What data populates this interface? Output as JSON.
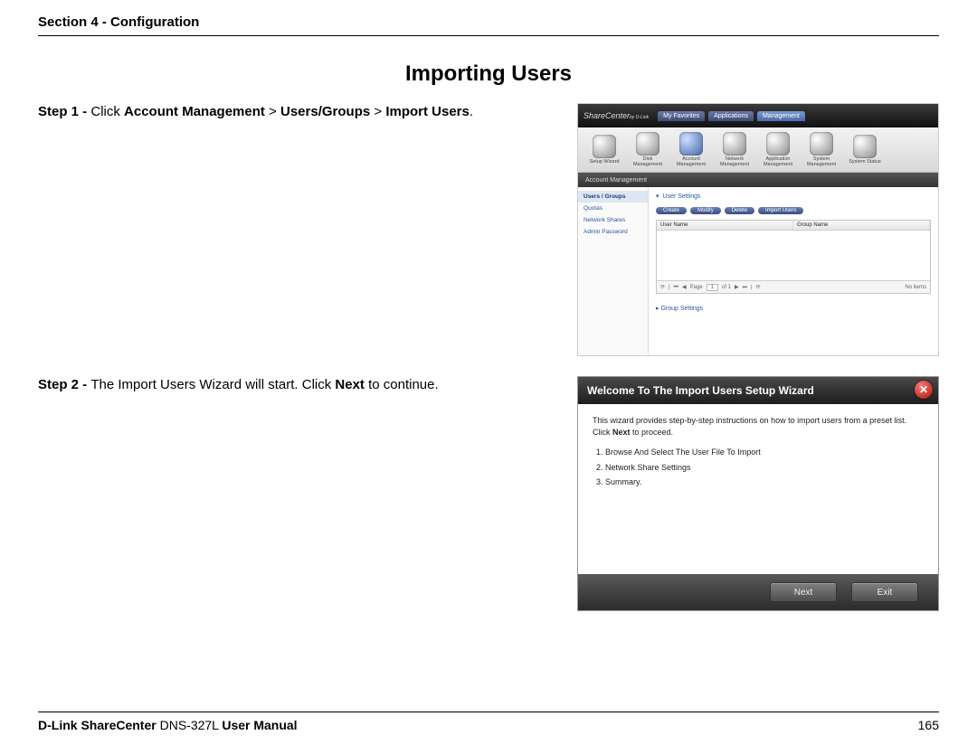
{
  "header": {
    "section": "Section 4 - Configuration"
  },
  "title": "Importing Users",
  "step1": {
    "prefix": "Step 1 - ",
    "before": "Click ",
    "bold1": "Account Management",
    "sep1": " > ",
    "bold2": "Users/Groups",
    "sep2": " > ",
    "bold3": "Import Users",
    "after": "."
  },
  "sharecenter": {
    "logo": "ShareCenter",
    "sublogo": "by D-Link",
    "tabs": [
      "My Favorites",
      "Applications",
      "Management"
    ],
    "tools": [
      "Setup Wizard",
      "Disk Management",
      "Account Management",
      "Network Management",
      "Application Management",
      "System Management",
      "System Status"
    ],
    "breadcrumb": "Account Management",
    "sidebar": [
      "Users / Groups",
      "Quotas",
      "Network Shares",
      "Admin Password"
    ],
    "user_settings_h": "User Settings",
    "buttons": [
      "Create",
      "Modify",
      "Delete",
      "Import Users"
    ],
    "cols": [
      "User Name",
      "Group Name"
    ],
    "pager": {
      "page_lbl": "Page",
      "page_val": "1",
      "of": "of 1",
      "no_items": "No items"
    },
    "group_h": "Group Settings"
  },
  "step2": {
    "prefix": "Step 2 - ",
    "before": "The Import Users Wizard will start. Click ",
    "bold": "Next",
    "after": " to continue."
  },
  "wizard": {
    "title": "Welcome To The Import Users Setup Wizard",
    "intro_before": "This wizard provides step-by-step instructions on how to import users from a preset list. Click ",
    "intro_bold": "Next",
    "intro_after": " to proceed.",
    "steps": [
      "Browse And Select The User File To Import",
      "Network Share Settings",
      "Summary."
    ],
    "next": "Next",
    "exit": "Exit"
  },
  "footer": {
    "brand": "D-Link ShareCenter",
    "model_part": " DNS-327L ",
    "doc": "User Manual",
    "page": "165"
  }
}
